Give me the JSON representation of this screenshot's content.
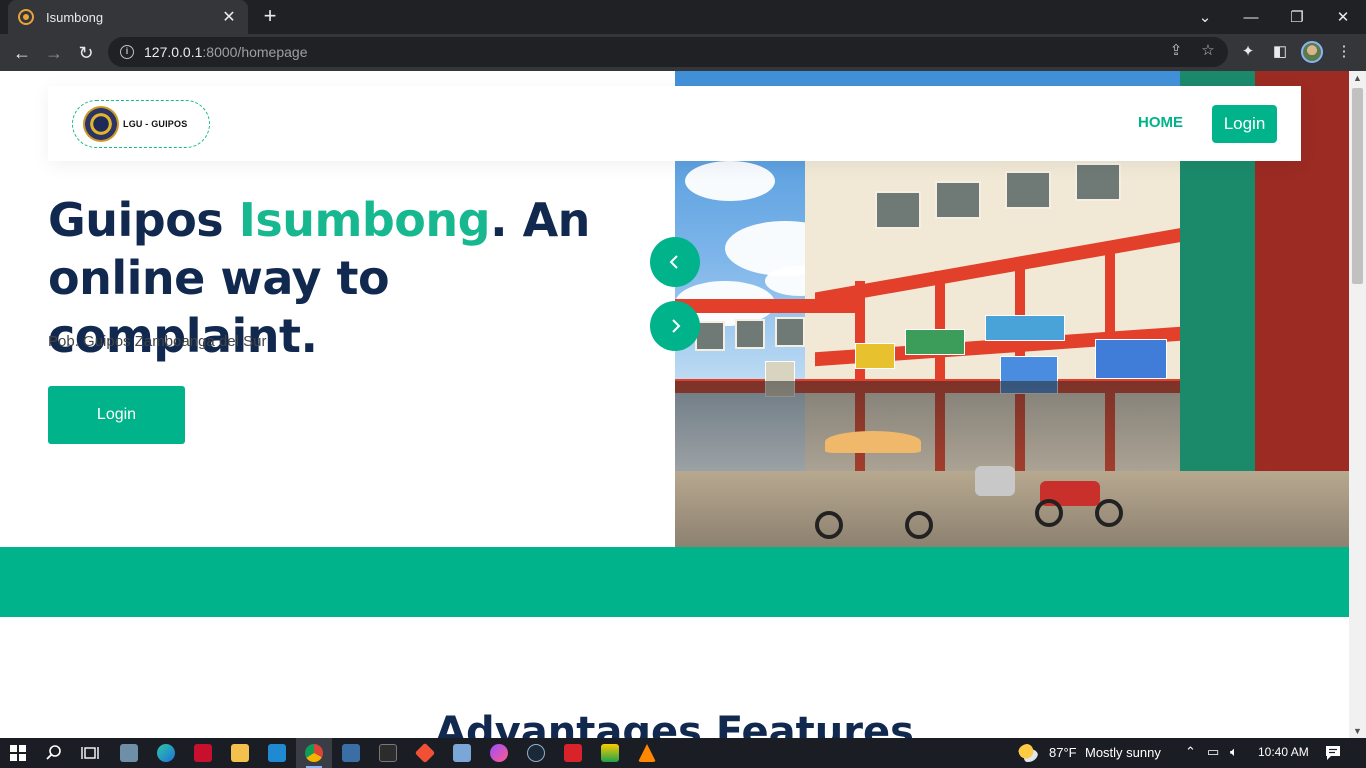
{
  "browser": {
    "tab_title": "Isumbong",
    "tab_close": "✕",
    "new_tab": "+",
    "url_host": "127.0.0.1",
    "url_path": ":8000/homepage"
  },
  "header": {
    "logo_text": "LGU  -  GUIPOS",
    "nav_home": "HOME",
    "nav_login": "Login"
  },
  "hero": {
    "title_part1": "Guipos ",
    "title_accent": "Isumbong",
    "title_part2": ". An online way to complaint.",
    "subtitle": "Pob. Guipos Zamboanga del Sur",
    "login_button": "Login"
  },
  "section": {
    "title": "Advantages Features"
  },
  "taskbar": {
    "weather_temp": "87°F",
    "weather_desc": "Mostly sunny",
    "time": "10:40 AM"
  },
  "colors": {
    "accent": "#00b38a",
    "navy": "#11284f"
  }
}
